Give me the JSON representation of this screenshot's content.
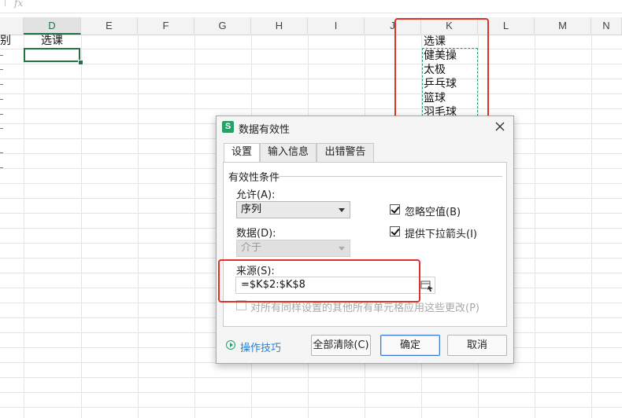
{
  "formula_bar": {
    "fx_label": "fx"
  },
  "columns": [
    "D",
    "E",
    "F",
    "G",
    "H",
    "I",
    "J",
    "K",
    "L",
    "M",
    "N"
  ],
  "active_column": "D",
  "cells": {
    "c_partial": "别",
    "d1": "选课",
    "k_values": [
      "选课",
      "健美操",
      "太极",
      "乒乓球",
      "篮球",
      "羽毛球"
    ]
  },
  "dialog": {
    "title": "数据有效性",
    "tabs": [
      "设置",
      "输入信息",
      "出错警告"
    ],
    "active_tab": "设置",
    "group_title": "有效性条件",
    "allow_label": "允许(A):",
    "allow_value": "序列",
    "data_label": "数据(D):",
    "data_value": "介于",
    "ignore_blank_label": "忽略空值(B)",
    "ignore_blank_checked": true,
    "dropdown_label": "提供下拉箭头(I)",
    "dropdown_checked": true,
    "source_label": "来源(S):",
    "source_value": "=$K$2:$K$8",
    "apply_all_label": "对所有同样设置的其他所有单元格应用这些更改(P)",
    "apply_all_checked": false,
    "tips_label": "操作技巧",
    "clear_all_label": "全部清除(C)",
    "ok_label": "确定",
    "cancel_label": "取消"
  },
  "colors": {
    "accent_green": "#217346",
    "highlight_red": "#e0302a",
    "link_blue": "#2d7fd1"
  }
}
